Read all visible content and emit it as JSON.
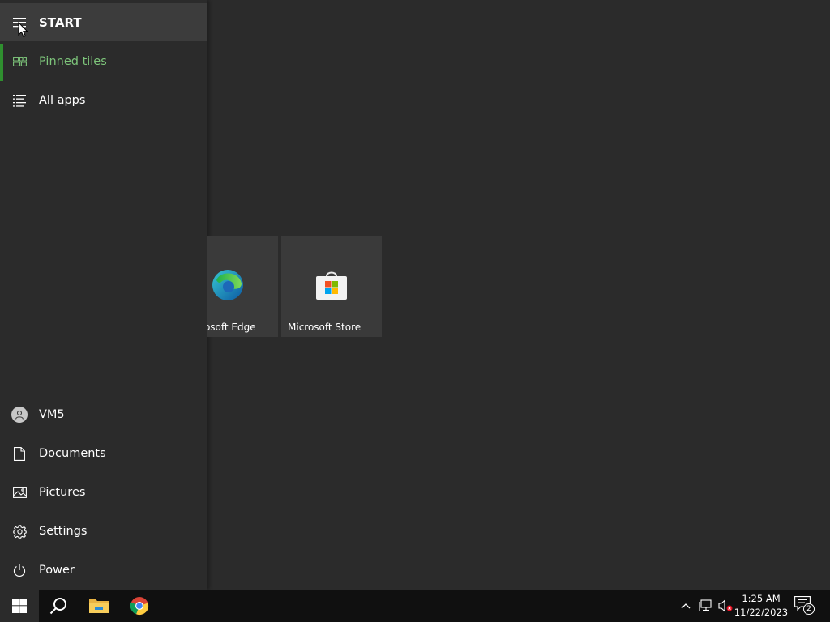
{
  "nav": {
    "start_label": "START",
    "pinned_label": "Pinned tiles",
    "allapps_label": "All apps",
    "user_label": "VM5",
    "documents_label": "Documents",
    "pictures_label": "Pictures",
    "settings_label": "Settings",
    "power_label": "Power"
  },
  "tiles": {
    "edge_label": "Microsoft Edge",
    "store_label": "Microsoft Store"
  },
  "taskbar": {
    "time": "1:25 AM",
    "date": "11/22/2023",
    "notification_count": "2"
  },
  "colors": {
    "accent": "#2f8f2f",
    "pinned_text": "#7dc47a",
    "background": "#2b2b2b",
    "taskbar": "#101010"
  },
  "icons": {
    "start": "hamburger-icon",
    "pinned": "tiles-icon",
    "allapps": "list-icon",
    "user": "user-avatar-icon",
    "documents": "document-icon",
    "pictures": "picture-icon",
    "settings": "gear-icon",
    "power": "power-icon"
  }
}
